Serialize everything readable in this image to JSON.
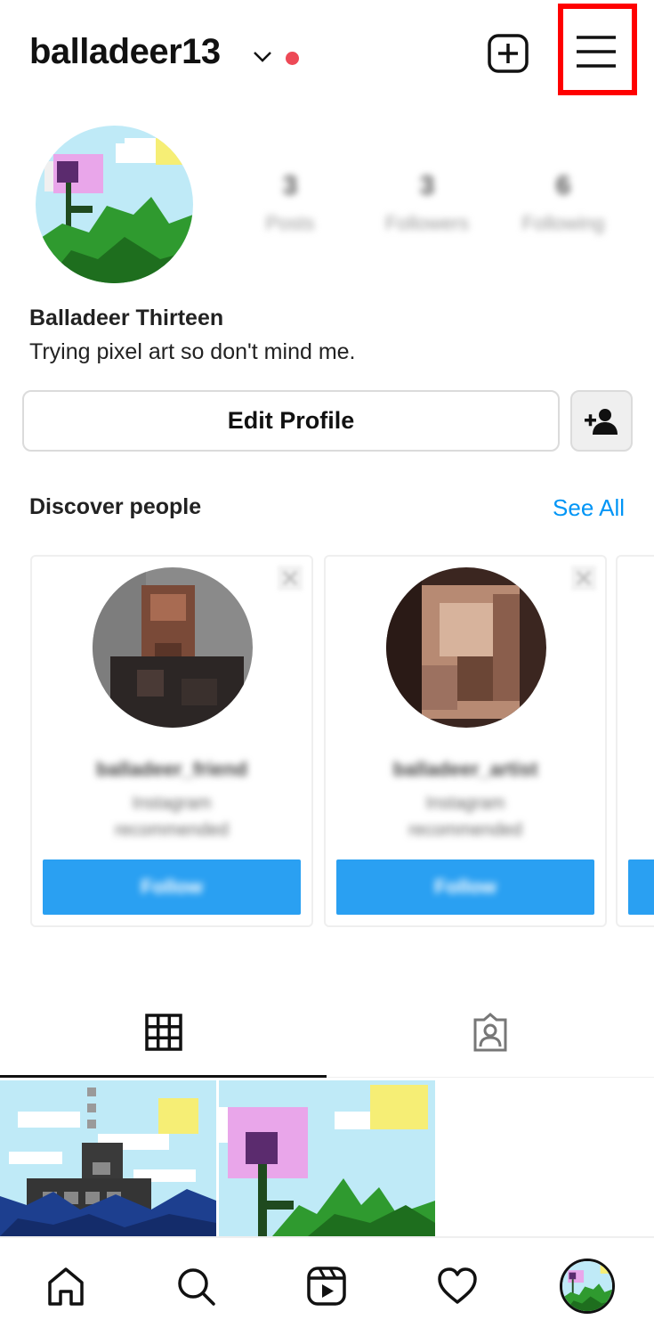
{
  "header": {
    "username": "balladeer13",
    "icons": [
      "chevron-down-icon",
      "notification-dot",
      "new-post-icon",
      "menu-icon"
    ],
    "accent_dot_color": "#ed4956",
    "highlight_color": "#ff0000"
  },
  "profile": {
    "full_name": "Balladeer Thirteen",
    "bio": "Trying pixel art so don't mind me.",
    "stats": [
      {
        "value": "3",
        "label": "Posts"
      },
      {
        "value": "3",
        "label": "Followers"
      },
      {
        "value": "6",
        "label": "Following"
      }
    ]
  },
  "actions": {
    "edit_profile_label": "Edit Profile",
    "add_person_icon": "add-person-icon"
  },
  "discover": {
    "title": "Discover people",
    "see_all_label": "See All",
    "link_color": "#0095f6",
    "cards": [
      {
        "name": "balladeer_friend",
        "subtitle": "Instagram recommended",
        "follow_label": "Follow"
      },
      {
        "name": "balladeer_artist",
        "subtitle": "Instagram recommended",
        "follow_label": "Follow"
      }
    ],
    "follow_color": "#2aa0f2"
  },
  "tabs": [
    {
      "icon": "grid-icon",
      "active": true
    },
    {
      "icon": "tagged-icon",
      "active": false
    }
  ],
  "posts": [
    {
      "subject": "pixel art ship on sea"
    },
    {
      "subject": "pixel art flower"
    }
  ],
  "bottom_nav": [
    {
      "icon": "home-icon"
    },
    {
      "icon": "search-icon"
    },
    {
      "icon": "reels-icon"
    },
    {
      "icon": "heart-icon"
    },
    {
      "icon": "profile-avatar"
    }
  ]
}
